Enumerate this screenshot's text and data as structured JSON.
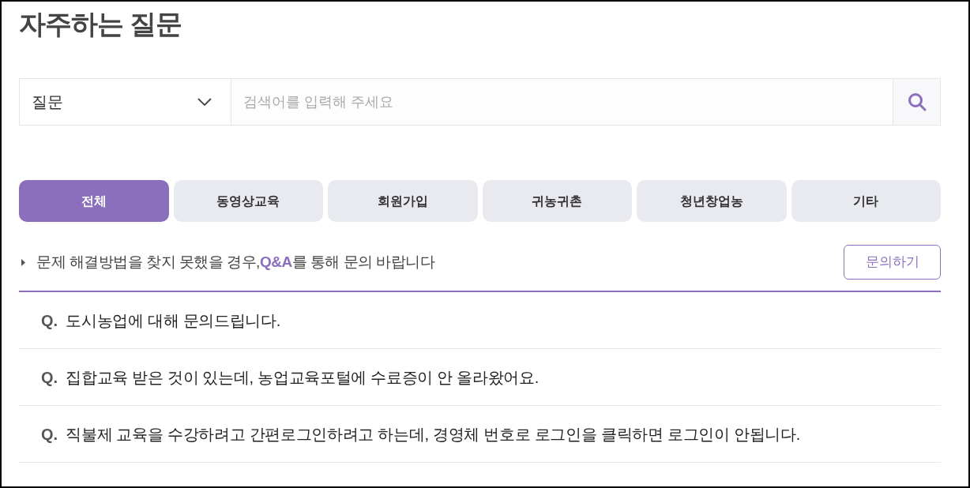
{
  "page": {
    "title": "자주하는 질문"
  },
  "search": {
    "category": "질문",
    "placeholder": "검색어를 입력해 주세요"
  },
  "tabs": [
    {
      "label": "전체",
      "selected": true
    },
    {
      "label": "동영상교육",
      "selected": false
    },
    {
      "label": "회원가입",
      "selected": false
    },
    {
      "label": "귀농귀촌",
      "selected": false
    },
    {
      "label": "청년창업농",
      "selected": false
    },
    {
      "label": "기타",
      "selected": false
    }
  ],
  "notice": {
    "before": "문제 해결방법을 찾지 못했을 경우,",
    "link": "Q&A",
    "after": "를 통해 문의 바랍니다",
    "button": "문의하기"
  },
  "faqs": [
    {
      "marker": "Q.",
      "question": "도시농업에 대해 문의드립니다."
    },
    {
      "marker": "Q.",
      "question": "집합교육 받은 것이 있는데, 농업교육포털에 수료증이 안 올라왔어요."
    },
    {
      "marker": "Q.",
      "question": "직불제 교육을 수강하려고 간편로그인하려고 하는데, 경영체 번호로 로그인을 클릭하면 로그인이 안됩니다."
    }
  ]
}
